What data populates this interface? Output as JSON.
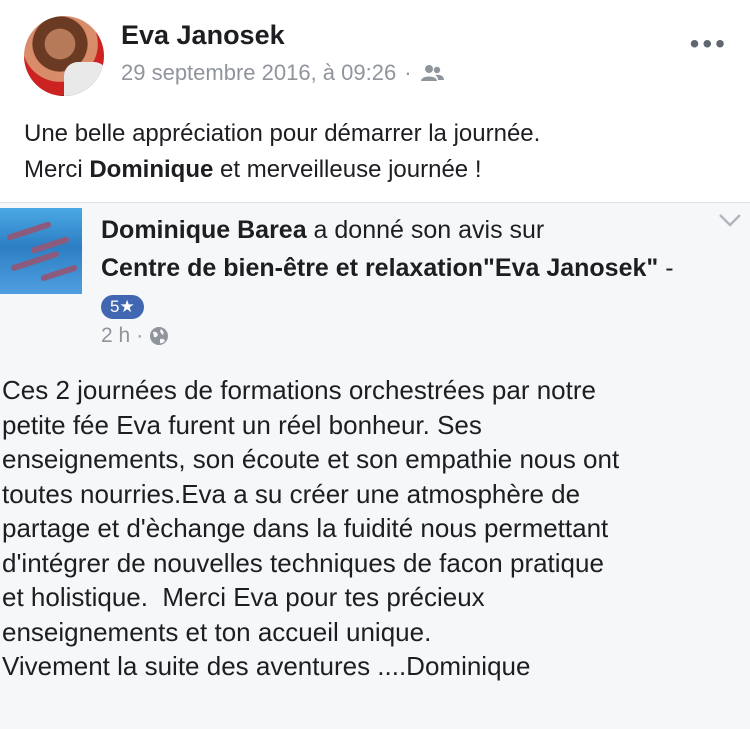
{
  "post": {
    "author": "Eva Janosek",
    "timestamp": "29 septembre 2016, à 09:26",
    "separator": "·",
    "audience_icon": "friends-icon",
    "more_icon": "more-options-icon",
    "line1": "Une belle appréciation pour démarrer la journée.",
    "line2_prefix": "Merci ",
    "line2_bold": "Dominique",
    "line2_suffix": " et merveilleuse journée !"
  },
  "review": {
    "reviewer": "Dominique Barea",
    "action": " a donné son avis sur",
    "page_name": "Centre de bien-être et relaxation\"Eva Janosek\"",
    "dash": " - ",
    "rating": "5★",
    "time": "2 h",
    "separator": "·",
    "privacy_icon": "globe-icon",
    "body": "Ces 2 journées de formations orchestrées par notre\npetite fée Eva furent un réel bonheur. Ses\nenseignements, son écoute et son empathie nous ont\ntoutes nourries.Eva a su créer une atmosphère de\npartage et d'èchange dans la fuidité nous permettant\nd'intégrer de nouvelles techniques de facon pratique\net holistique.  Merci Eva pour tes précieux\nenseignements et ton accueil unique.\nVivement la suite des aventures ....Dominique"
  }
}
